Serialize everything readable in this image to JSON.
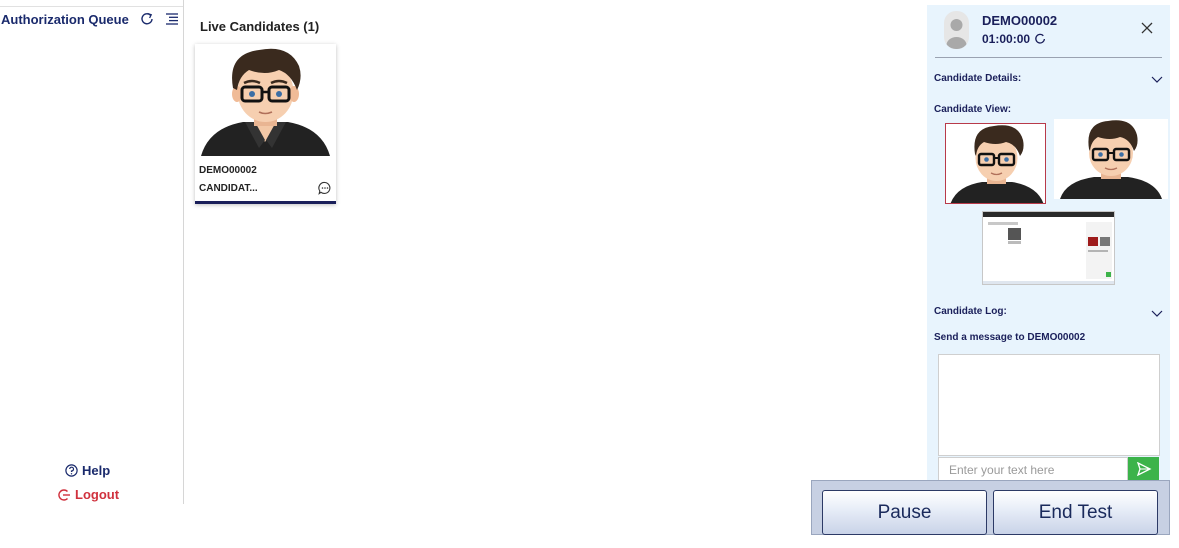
{
  "sidebar": {
    "title": "Authorization Queue",
    "help_label": "Help",
    "logout_label": "Logout"
  },
  "main": {
    "title": "Live Candidates (1)",
    "candidates": [
      {
        "id": "DEMO00002",
        "name": "CANDIDAT..."
      }
    ]
  },
  "panel": {
    "candidate_id": "DEMO00002",
    "timer": "01:00:00",
    "details_label": "Candidate Details:",
    "view_label": "Candidate View:",
    "log_label": "Candidate Log:",
    "message_label": "Send a message to DEMO00002",
    "input_placeholder": "Enter your text here"
  },
  "actions": {
    "pause_label": "Pause",
    "end_label": "End Test"
  },
  "colors": {
    "brand_navy": "#1a1f5a",
    "logout_red": "#d0313d",
    "send_green": "#3cb34a",
    "panel_bg": "#e8f4fd"
  },
  "icons": [
    "refresh-icon",
    "menu-list-icon",
    "help-circle-icon",
    "logout-icon",
    "chat-bubble-icon",
    "close-icon",
    "chevron-down-icon",
    "send-icon"
  ]
}
